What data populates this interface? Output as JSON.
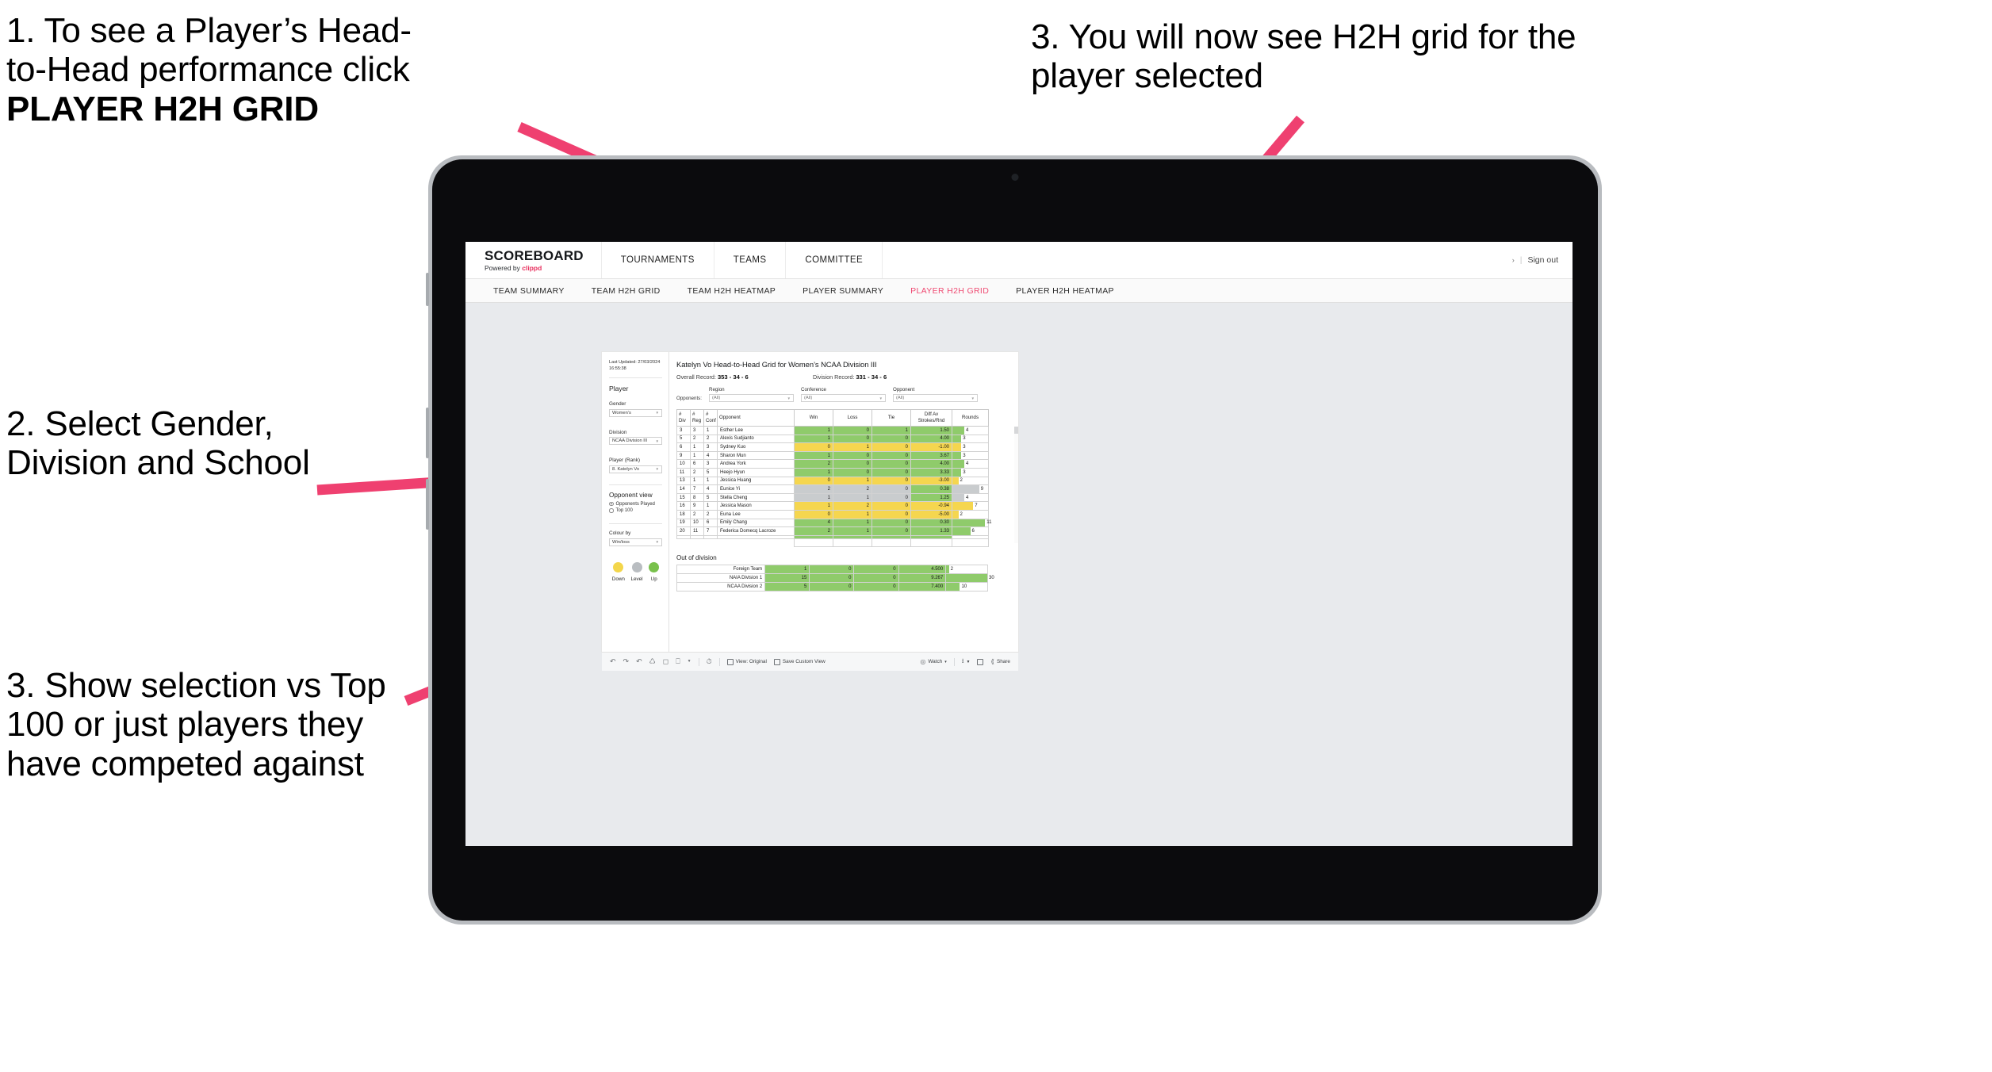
{
  "annotations": [
    {
      "id": "anno-1",
      "line1": "1. To see a Player’s Head-",
      "line2": "to-Head performance click",
      "bold": "PLAYER H2H GRID"
    },
    {
      "id": "anno-2",
      "text": "2. Select Gender, Division and School"
    },
    {
      "id": "anno-3",
      "text": "3. Show selection vs Top 100 or just players they have competed against"
    },
    {
      "id": "anno-4",
      "text": "3. You will now see H2H grid for the player selected"
    }
  ],
  "app": {
    "brand": {
      "name": "SCOREBOARD",
      "powered_prefix": "Powered by ",
      "powered_brand": "clippd"
    },
    "top_nav": [
      "TOURNAMENTS",
      "TEAMS",
      "COMMITTEE"
    ],
    "top_right": {
      "chevron": "›",
      "separator": "|",
      "sign_out": "Sign out"
    },
    "sub_nav": [
      {
        "label": "TEAM SUMMARY",
        "active": false
      },
      {
        "label": "TEAM H2H GRID",
        "active": false
      },
      {
        "label": "TEAM H2H HEATMAP",
        "active": false
      },
      {
        "label": "PLAYER SUMMARY",
        "active": false
      },
      {
        "label": "PLAYER H2H GRID",
        "active": true
      },
      {
        "label": "PLAYER H2H HEATMAP",
        "active": false
      }
    ]
  },
  "sidebar": {
    "last_updated": "Last Updated: 27/03/2024 16:55:38",
    "player_heading": "Player",
    "fields": [
      {
        "label": "Gender",
        "value": "Women's"
      },
      {
        "label": "Division",
        "value": "NCAA Division III"
      },
      {
        "label": "Player (Rank)",
        "value": "8. Katelyn Vo"
      }
    ],
    "opponent_view": {
      "heading": "Opponent view",
      "options": [
        {
          "label": "Opponents Played",
          "selected": true
        },
        {
          "label": "Top 100",
          "selected": false
        }
      ]
    },
    "colour_by": {
      "label": "Colour by",
      "value": "Win/loss"
    },
    "legend": [
      {
        "label": "Down",
        "color": "#f3d64b"
      },
      {
        "label": "Level",
        "color": "#b9bdc1"
      },
      {
        "label": "Up",
        "color": "#79c14c"
      }
    ]
  },
  "viz": {
    "title": "Katelyn Vo Head-to-Head Grid for Women’s NCAA Division III",
    "overall_record_label": "Overall Record:",
    "overall_record_value": "353 -  34 - 6",
    "division_record_label": "Division Record:",
    "division_record_value": "331 -  34 - 6",
    "opponents_label": "Opponents:",
    "filters": [
      {
        "label": "Region",
        "value": "(All)"
      },
      {
        "label": "Conference",
        "value": "(All)"
      },
      {
        "label": "Opponent",
        "value": "(All)"
      }
    ],
    "columns": [
      "# Div",
      "# Reg",
      "# Conf",
      "Opponent",
      "Win",
      "Loss",
      "Tie",
      "Diff Av Strokes/Rnd",
      "Rounds"
    ],
    "column_lines": [
      [
        "#",
        "Div"
      ],
      [
        "#",
        "Reg"
      ],
      [
        "#",
        "Conf"
      ],
      [
        "Opponent"
      ],
      [
        "Win"
      ],
      [
        "Loss"
      ],
      [
        "Tie"
      ],
      [
        "Diff Av",
        "Strokes/Rnd"
      ],
      [
        "Rounds"
      ]
    ],
    "rows": [
      {
        "div": "3",
        "reg": "3",
        "conf": "1",
        "opponent": "Esther Lee",
        "win": "1",
        "loss": "0",
        "tie": "1",
        "diff": "1.50",
        "rounds": "4",
        "color": "#8fcb6b"
      },
      {
        "div": "5",
        "reg": "2",
        "conf": "2",
        "opponent": "Alexis Sudjianto",
        "win": "1",
        "loss": "0",
        "tie": "0",
        "diff": "4.00",
        "rounds": "3",
        "color": "#8fcb6b"
      },
      {
        "div": "6",
        "reg": "1",
        "conf": "3",
        "opponent": "Sydney Kuo",
        "win": "0",
        "loss": "1",
        "tie": "0",
        "diff": "-1.00",
        "rounds": "3",
        "color": "#f5d64f"
      },
      {
        "div": "9",
        "reg": "1",
        "conf": "4",
        "opponent": "Sharon Mun",
        "win": "1",
        "loss": "0",
        "tie": "0",
        "diff": "3.67",
        "rounds": "3",
        "color": "#8fcb6b"
      },
      {
        "div": "10",
        "reg": "6",
        "conf": "3",
        "opponent": "Andrea York",
        "win": "2",
        "loss": "0",
        "tie": "0",
        "diff": "4.00",
        "rounds": "4",
        "color": "#8fcb6b"
      },
      {
        "div": "11",
        "reg": "2",
        "conf": "5",
        "opponent": "Heejo Hyun",
        "win": "1",
        "loss": "0",
        "tie": "0",
        "diff": "3.33",
        "rounds": "3",
        "color": "#8fcb6b"
      },
      {
        "div": "13",
        "reg": "1",
        "conf": "1",
        "opponent": "Jessica Huang",
        "win": "0",
        "loss": "1",
        "tie": "0",
        "diff": "-3.00",
        "rounds": "2",
        "color": "#f5d64f"
      },
      {
        "div": "14",
        "reg": "7",
        "conf": "4",
        "opponent": "Eunice Yi",
        "win": "2",
        "loss": "2",
        "tie": "0",
        "diff": "0.38",
        "rounds": "9",
        "color": "#c9ccce",
        "diff_color": "#8fcb6b"
      },
      {
        "div": "15",
        "reg": "8",
        "conf": "5",
        "opponent": "Stella Cheng",
        "win": "1",
        "loss": "1",
        "tie": "0",
        "diff": "1.25",
        "rounds": "4",
        "color": "#c9ccce",
        "diff_color": "#8fcb6b"
      },
      {
        "div": "16",
        "reg": "9",
        "conf": "1",
        "opponent": "Jessica Mason",
        "win": "1",
        "loss": "2",
        "tie": "0",
        "diff": "-0.94",
        "rounds": "7",
        "color": "#f5d64f"
      },
      {
        "div": "18",
        "reg": "2",
        "conf": "2",
        "opponent": "Euna Lee",
        "win": "0",
        "loss": "1",
        "tie": "0",
        "diff": "-5.00",
        "rounds": "2",
        "color": "#f5d64f"
      },
      {
        "div": "19",
        "reg": "10",
        "conf": "6",
        "opponent": "Emily Chang",
        "win": "4",
        "loss": "1",
        "tie": "0",
        "diff": "0.30",
        "rounds": "11",
        "color": "#8fcb6b"
      },
      {
        "div": "20",
        "reg": "11",
        "conf": "7",
        "opponent": "Federica Domecq Lacroze",
        "win": "2",
        "loss": "1",
        "tie": "0",
        "diff": "1.33",
        "rounds": "6",
        "color": "#8fcb6b"
      }
    ],
    "out_of_division": {
      "title": "Out of division",
      "rows": [
        {
          "name": "Foreign Team",
          "win": "1",
          "loss": "0",
          "tie": "0",
          "diff": "4.500",
          "rounds": "2",
          "color": "#8fcb6b"
        },
        {
          "name": "NAIA Division 1",
          "win": "15",
          "loss": "0",
          "tie": "0",
          "diff": "9.267",
          "rounds": "30",
          "color": "#8fcb6b"
        },
        {
          "name": "NCAA Division 2",
          "win": "5",
          "loss": "0",
          "tie": "0",
          "diff": "7.400",
          "rounds": "10",
          "color": "#8fcb6b"
        }
      ]
    }
  },
  "toolbar": {
    "icons": [
      "undo-icon",
      "redo-icon",
      "revert-icon",
      "refresh-icon",
      "pause-icon",
      "shape-icon",
      "caret-icon",
      "clock-icon"
    ],
    "view_original": "View: Original",
    "save_custom_view": "Save Custom View",
    "watch": "Watch",
    "watch_caret": "▾",
    "share": "Share"
  },
  "chart_data": {
    "type": "table",
    "title": "Katelyn Vo Head-to-Head Grid for Women’s NCAA Division III",
    "columns": [
      "# Div",
      "# Reg",
      "# Conf",
      "Opponent",
      "Win",
      "Loss",
      "Tie",
      "Diff Av Strokes/Rnd",
      "Rounds"
    ],
    "rows": [
      [
        "3",
        "3",
        "1",
        "Esther Lee",
        1,
        0,
        1,
        1.5,
        4
      ],
      [
        "5",
        "2",
        "2",
        "Alexis Sudjianto",
        1,
        0,
        0,
        4.0,
        3
      ],
      [
        "6",
        "1",
        "3",
        "Sydney Kuo",
        0,
        1,
        0,
        -1.0,
        3
      ],
      [
        "9",
        "1",
        "4",
        "Sharon Mun",
        1,
        0,
        0,
        3.67,
        3
      ],
      [
        "10",
        "6",
        "3",
        "Andrea York",
        2,
        0,
        0,
        4.0,
        4
      ],
      [
        "11",
        "2",
        "5",
        "Heejo Hyun",
        1,
        0,
        0,
        3.33,
        3
      ],
      [
        "13",
        "1",
        "1",
        "Jessica Huang",
        0,
        1,
        0,
        -3.0,
        2
      ],
      [
        "14",
        "7",
        "4",
        "Eunice Yi",
        2,
        2,
        0,
        0.38,
        9
      ],
      [
        "15",
        "8",
        "5",
        "Stella Cheng",
        1,
        1,
        0,
        1.25,
        4
      ],
      [
        "16",
        "9",
        "1",
        "Jessica Mason",
        1,
        2,
        0,
        -0.94,
        7
      ],
      [
        "18",
        "2",
        "2",
        "Euna Lee",
        0,
        1,
        0,
        -5.0,
        2
      ],
      [
        "19",
        "10",
        "6",
        "Emily Chang",
        4,
        1,
        0,
        0.3,
        11
      ],
      [
        "20",
        "11",
        "7",
        "Federica Domecq Lacroze",
        2,
        1,
        0,
        1.33,
        6
      ]
    ],
    "out_of_division_rows": [
      [
        "Foreign Team",
        1,
        0,
        0,
        4.5,
        2
      ],
      [
        "NAIA Division 1",
        15,
        0,
        0,
        9.267,
        30
      ],
      [
        "NCAA Division 2",
        5,
        0,
        0,
        7.4,
        10
      ]
    ],
    "colour_legend": {
      "Down": "#f3d64b",
      "Level": "#b9bdc1",
      "Up": "#79c14c"
    },
    "rounds_max": 30
  }
}
